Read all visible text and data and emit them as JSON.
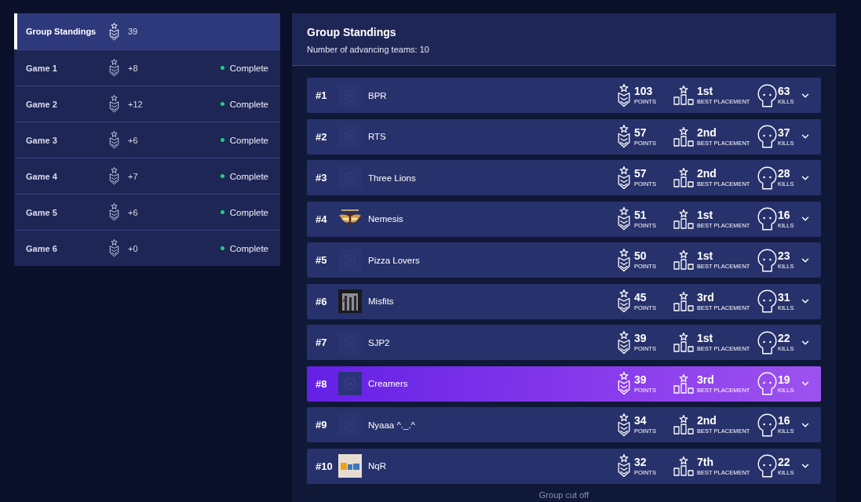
{
  "sidebar": {
    "items": [
      {
        "label": "Group Standings",
        "points": "39",
        "selected": true
      },
      {
        "label": "Game 1",
        "points": "+8",
        "status": "Complete",
        "selected": false
      },
      {
        "label": "Game 2",
        "points": "+12",
        "status": "Complete",
        "selected": false
      },
      {
        "label": "Game 3",
        "points": "+6",
        "status": "Complete",
        "selected": false
      },
      {
        "label": "Game 4",
        "points": "+7",
        "status": "Complete",
        "selected": false
      },
      {
        "label": "Game 5",
        "points": "+6",
        "status": "Complete",
        "selected": false
      },
      {
        "label": "Game 6",
        "points": "+0",
        "status": "Complete",
        "selected": false
      }
    ]
  },
  "standings": {
    "title": "Group Standings",
    "subtitle": "Number of advancing teams: 10",
    "rows": [
      {
        "rank": "#1",
        "logo": {
          "kind": "placeholder"
        },
        "team": "BPR",
        "points": "103",
        "points_label": "POINTS",
        "placement": "1st",
        "placement_label": "BEST PLACEMENT",
        "kills": "63",
        "kills_label": "KILLS",
        "highlighted": false
      },
      {
        "rank": "#2",
        "logo": {
          "kind": "placeholder"
        },
        "team": "RTS",
        "points": "57",
        "points_label": "POINTS",
        "placement": "2nd",
        "placement_label": "BEST PLACEMENT",
        "kills": "37",
        "kills_label": "KILLS",
        "highlighted": false
      },
      {
        "rank": "#3",
        "logo": {
          "kind": "placeholder"
        },
        "team": "Three Lions",
        "points": "57",
        "points_label": "POINTS",
        "placement": "2nd",
        "placement_label": "BEST PLACEMENT",
        "kills": "28",
        "kills_label": "KILLS",
        "highlighted": false
      },
      {
        "rank": "#4",
        "logo": {
          "kind": "wings"
        },
        "team": "Nemesis",
        "points": "51",
        "points_label": "POINTS",
        "placement": "1st",
        "placement_label": "BEST PLACEMENT",
        "kills": "16",
        "kills_label": "KILLS",
        "highlighted": false
      },
      {
        "rank": "#5",
        "logo": {
          "kind": "placeholder"
        },
        "team": "Pizza Lovers",
        "points": "50",
        "points_label": "POINTS",
        "placement": "1st",
        "placement_label": "BEST PLACEMENT",
        "kills": "23",
        "kills_label": "KILLS",
        "highlighted": false
      },
      {
        "rank": "#6",
        "logo": {
          "kind": "photo"
        },
        "team": "Misfits",
        "points": "45",
        "points_label": "POINTS",
        "placement": "3rd",
        "placement_label": "BEST PLACEMENT",
        "kills": "31",
        "kills_label": "KILLS",
        "highlighted": false
      },
      {
        "rank": "#7",
        "logo": {
          "kind": "placeholder"
        },
        "team": "SJP2",
        "points": "39",
        "points_label": "POINTS",
        "placement": "1st",
        "placement_label": "BEST PLACEMENT",
        "kills": "22",
        "kills_label": "KILLS",
        "highlighted": false
      },
      {
        "rank": "#8",
        "logo": {
          "kind": "placeholder"
        },
        "team": "Creamers",
        "points": "39",
        "points_label": "POINTS",
        "placement": "3rd",
        "placement_label": "BEST PLACEMENT",
        "kills": "19",
        "kills_label": "KILLS",
        "highlighted": true
      },
      {
        "rank": "#9",
        "logo": {
          "kind": "placeholder"
        },
        "team": "Nyaaa ^._.^",
        "points": "34",
        "points_label": "POINTS",
        "placement": "2nd",
        "placement_label": "BEST PLACEMENT",
        "kills": "16",
        "kills_label": "KILLS",
        "highlighted": false
      },
      {
        "rank": "#10",
        "logo": {
          "kind": "tile"
        },
        "team": "NqR",
        "points": "32",
        "points_label": "POINTS",
        "placement": "7th",
        "placement_label": "BEST PLACEMENT",
        "kills": "22",
        "kills_label": "KILLS",
        "highlighted": false
      }
    ],
    "footer": "Group cut off"
  }
}
